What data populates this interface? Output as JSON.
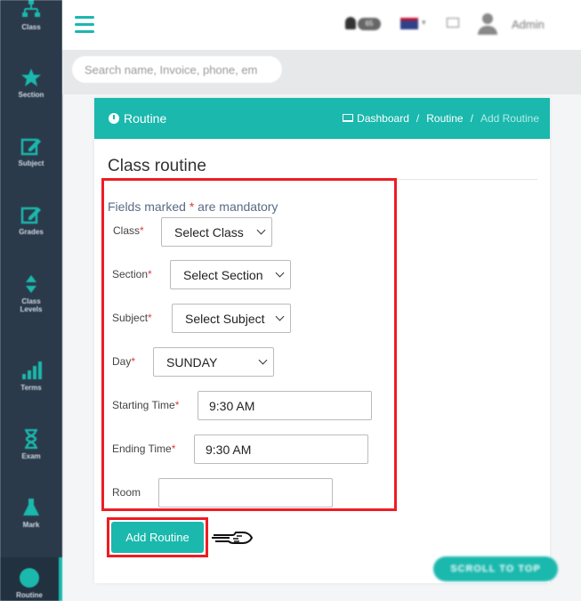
{
  "sidebar": {
    "items": [
      {
        "label": "Class",
        "icon": "sitemap-icon"
      },
      {
        "label": "Section",
        "icon": "star-icon"
      },
      {
        "label": "Subject",
        "icon": "edit-icon"
      },
      {
        "label": "Grades",
        "icon": "edit-icon"
      },
      {
        "label": "Class",
        "label2": "Levels",
        "icon": "sort-icon"
      },
      {
        "label": "Terms",
        "icon": "signal-icon"
      },
      {
        "label": "Exam",
        "icon": "hourglass-icon"
      },
      {
        "label": "Mark",
        "icon": "flask-icon"
      },
      {
        "label": "Routine",
        "icon": "clock-icon"
      }
    ]
  },
  "header": {
    "notifications_count": "65",
    "user_name": "Admin"
  },
  "search": {
    "placeholder": "Search name, Invoice, phone, em"
  },
  "card": {
    "title": "Routine",
    "breadcrumb": {
      "dashboard": "Dashboard",
      "sep": "/",
      "routine": "Routine",
      "current": "Add Routine"
    },
    "section_title": "Class routine",
    "mandatory_prefix": "Fields marked",
    "mandatory_star": "*",
    "mandatory_suffix": "are mandatory"
  },
  "form": {
    "class_label": "Class",
    "class_value": "Select Class",
    "section_label": "Section",
    "section_value": "Select Section",
    "subject_label": "Subject",
    "subject_value": "Select Subject",
    "day_label": "Day",
    "day_value": "SUNDAY",
    "start_label": "Starting Time",
    "start_value": "9:30 AM",
    "end_label": "Ending Time",
    "end_value": "9:30 AM",
    "room_label": "Room",
    "room_value": "",
    "required_mark": "*"
  },
  "actions": {
    "add_label": "Add Routine",
    "scroll_top_label": "SCROLL TO TOP"
  },
  "colors": {
    "accent": "#1ab8ad",
    "sidebar": "#2b3a4a",
    "highlight_border": "#ee1c24"
  }
}
